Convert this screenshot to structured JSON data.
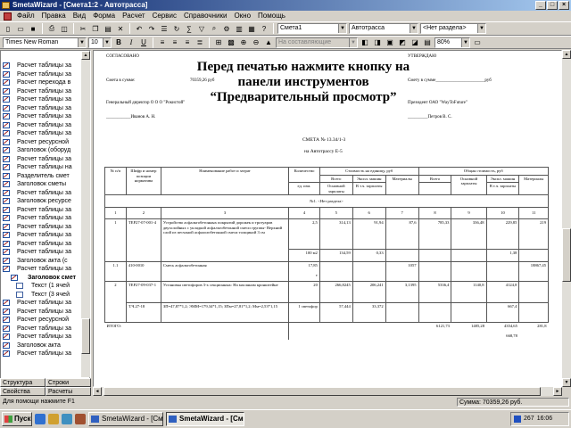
{
  "window": {
    "title": "SmetaWizard - [Смета1:2 - Автотрасса]"
  },
  "menu": [
    "Файл",
    "Правка",
    "Вид",
    "Форма",
    "Расчет",
    "Сервис",
    "Справочники",
    "Окно",
    "Помощь"
  ],
  "toolbar1": {
    "combo1": "Смета1",
    "combo2": "Автотрасса",
    "combo3": "<Нет раздела>"
  },
  "toolbar2": {
    "font": "Times New Roman",
    "size": "10",
    "style_combo": "На составляющие",
    "zoom": "80%"
  },
  "tree": [
    {
      "label": "Расчет таблицы за",
      "level": 0
    },
    {
      "label": "Расчет таблицы за",
      "level": 0
    },
    {
      "label": "Расчет перехода в",
      "level": 0
    },
    {
      "label": "Расчет таблицы за",
      "level": 0
    },
    {
      "label": "Расчет таблицы за",
      "level": 0
    },
    {
      "label": "Расчет таблицы за",
      "level": 0
    },
    {
      "label": "Расчет таблицы за",
      "level": 0
    },
    {
      "label": "Расчет таблицы за",
      "level": 0
    },
    {
      "label": "Расчет таблицы за",
      "level": 0
    },
    {
      "label": "Расчет ресурсной",
      "level": 0
    },
    {
      "label": "Заголовок (оборуд",
      "level": 0
    },
    {
      "label": "Расчет таблицы за",
      "level": 0
    },
    {
      "label": "Расчет таблицы на",
      "level": 0
    },
    {
      "label": "Разделитель смет",
      "level": 0
    },
    {
      "label": "Заголовок сметы",
      "level": 0
    },
    {
      "label": "Расчет таблицы за",
      "level": 0
    },
    {
      "label": "Заголовок ресурсе",
      "level": 0
    },
    {
      "label": "Расчет таблицы за",
      "level": 0
    },
    {
      "label": "Расчет таблицы за",
      "level": 0
    },
    {
      "label": "Расчет таблицы за",
      "level": 0
    },
    {
      "label": "Расчет таблицы за",
      "level": 0
    },
    {
      "label": "Расчет таблицы за",
      "level": 0
    },
    {
      "label": "Расчет таблицы за",
      "level": 0
    },
    {
      "label": "Заголовок акта (с",
      "level": 0
    },
    {
      "label": "Расчет таблицы за",
      "level": 0
    },
    {
      "label": "Заголовок смет",
      "level": 1
    },
    {
      "label": "Текст (1 ячей",
      "level": 2
    },
    {
      "label": "Текст (3 ячей",
      "level": 2
    },
    {
      "label": "Расчет таблицы за",
      "level": 0
    },
    {
      "label": "Расчет таблицы за",
      "level": 0
    },
    {
      "label": "Расчет ресурсной",
      "level": 0
    },
    {
      "label": "Расчет таблицы за",
      "level": 0
    },
    {
      "label": "Расчет таблицы за",
      "level": 0
    },
    {
      "label": "Заголовок акта",
      "level": 0
    },
    {
      "label": "Расчет таблицы за",
      "level": 0
    }
  ],
  "left_tabs": {
    "structure": "Структура",
    "rows": "Строки",
    "properties": "Свойства",
    "calcs": "Расчеты"
  },
  "document": {
    "agreed": "СОГЛАСОВАНО",
    "approve": "УТВЕРЖДАЮ",
    "sum_left": "Смета в сумме:",
    "sum_left_value": "70359,26 руб",
    "sum_right": "Смету в сумме______________________руб",
    "dir_left": "Генеральный директор  О О О  \"Рокистой\"",
    "dir_right": "Президент ОАО \"WayToFuture\"",
    "sign_left": "___________Иванов А. Н.",
    "sign_right": "_________Петров В. С.",
    "smeta_no": "СМЕТА № 13.34/1-3",
    "smeta_on": "на Автотрассу Е-5",
    "overlay": "Перед печатью нажмите кнопку на панели инструментов “Предварительный просмотр”",
    "table": {
      "h_no": "№ п/п",
      "h_code": "Шифр и номер позиции норматива",
      "h_name": "Наименование работ и затрат",
      "h_qty": "Количество",
      "h_unit": "ед. изм.",
      "h_unit_cost": "Стоимость на единицу, руб",
      "h_total_cost": "Общая стоимость, руб",
      "h_total": "Всего",
      "h_machines": "Экспл. машин",
      "h_materials": "Материалы",
      "h_main": "Основной зарплаты",
      "h_incl": "В т.ч. зарплаты",
      "section": "№1. <Нет раздела>",
      "nums": [
        "1",
        "2",
        "3",
        "4",
        "5",
        "6",
        "7",
        "8",
        "9",
        "10",
        "11"
      ],
      "r1_no": "1",
      "r1_code": "ТЕР27-07-001-4",
      "r1_name": "Устройство асфальтобетонных покрытий дорожек и тротуаров двухслойных с укладкой асфальтобетонной смеси группы- Верхний слой из песчаной асфальтобетонной смеси толщиной 3 см",
      "r1_qty": "2,5",
      "r1_v": [
        "314,13",
        "91,94",
        "87,6",
        "785,33",
        "336,48",
        "229,85",
        "219"
      ],
      "r1_unit": "100 м2",
      "r1_sub": [
        "134,59",
        "0,33"
      ],
      "r1_sub_right": "1,38",
      "r2_no": "1.1",
      "r2_code": "410-0010",
      "r2_name": "Смесь асфальтобетонная",
      "r2_qty": "17,85",
      "r2_unit": "т",
      "r2_mat": "1057",
      "r2_right": "18867,45",
      "r3_no": "2",
      "r3_code": "ТЕР27-09-037-1",
      "r3_name": "Установка светофоров 3-х секционных: На масляном кронштейне",
      "r3_qty": "20",
      "r3_v": [
        "266,8245",
        "206,241",
        "3,1395",
        "5336,4",
        "1140,8",
        "4124,8"
      ],
      "r3_coef_code": "Т.Ч.27-18",
      "r3_coef": "ЗП=47,87*1,2; ЭММ=179,34*1,15; ЗПм=27,81*1,2; Мм=2,53*1,15",
      "r3_unit": "1 светофор",
      "r3_sub": [
        "57,444",
        "33,372"
      ],
      "r3_right": "667,4",
      "total_label": "ИТОГО:",
      "total": [
        "6121,73",
        "1485,28",
        "4354,65",
        "281,8"
      ],
      "total_sub": "668,78"
    }
  },
  "status": {
    "left": "Для помощи нажмите F1",
    "right": "Сумма: 70359,26 руб."
  },
  "taskbar": {
    "start": "Пуск",
    "tasks": [
      "SmetaWizard - [Смет...",
      "SmetaWizard - [Смет..."
    ],
    "clock": "16:06",
    "tray_num": "267"
  }
}
